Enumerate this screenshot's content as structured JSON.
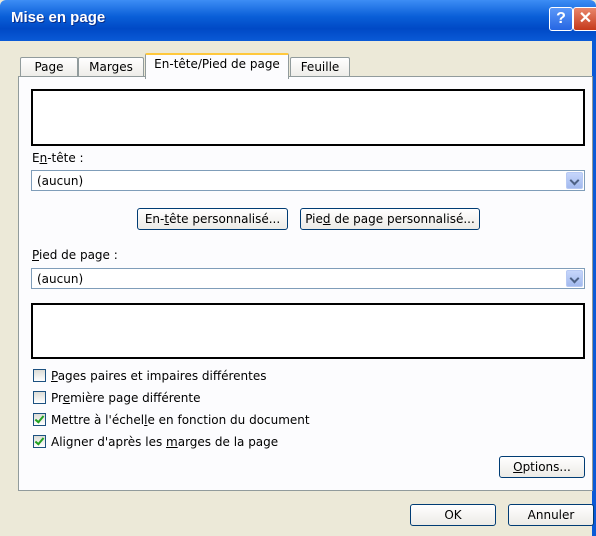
{
  "window": {
    "title": "Mise en page",
    "help_glyph": "?",
    "close_glyph": "✕"
  },
  "tabs": [
    {
      "label": "Page",
      "active": false
    },
    {
      "label": "Marges",
      "active": false
    },
    {
      "label": "En-tête/Pied de page",
      "active": true
    },
    {
      "label": "Feuille",
      "active": false
    }
  ],
  "header": {
    "label_pre": "E",
    "label_u": "n",
    "label_post": "-tête :",
    "selected": "(aucun)",
    "custom_button": {
      "pre": "En-",
      "u": "t",
      "post": "ête personnalisé..."
    }
  },
  "footer": {
    "label_u": "P",
    "label_post": "ied de page :",
    "selected": "(aucun)",
    "custom_button": {
      "pre": "Pie",
      "u": "d",
      "post": " de page personnalisé..."
    }
  },
  "options": [
    {
      "pre": "",
      "u": "P",
      "post": "ages paires et impaires différentes",
      "checked": false
    },
    {
      "pre": "Pr",
      "u": "e",
      "post": "mière page différente",
      "checked": false
    },
    {
      "pre": "Mettre à l'échel",
      "u": "l",
      "post": "e en fonction du document",
      "checked": true
    },
    {
      "pre": "Aligner d'après les ",
      "u": "m",
      "post": "arges de la page",
      "checked": true
    }
  ],
  "buttons": {
    "options": {
      "u": "O",
      "post": "ptions..."
    },
    "ok": "OK",
    "cancel": "Annuler"
  }
}
